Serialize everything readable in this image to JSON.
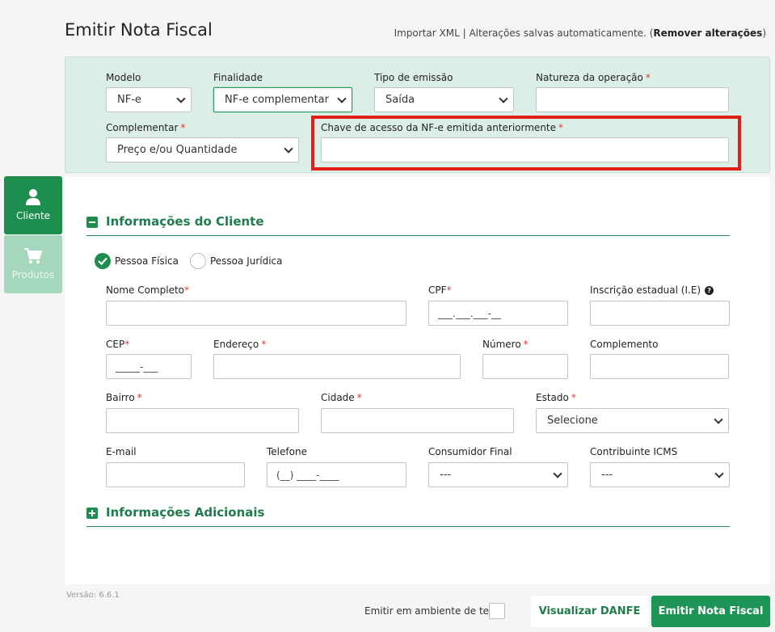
{
  "header": {
    "title": "Emitir Nota Fiscal",
    "import_xml": "Importar XML",
    "separator": "|",
    "autosave_text": "Alterações salvas automaticamente.",
    "remove_open": "(",
    "remove_label": "Remover alterações",
    "remove_close": ")"
  },
  "top_form": {
    "modelo": {
      "label": "Modelo",
      "value": "NF-e"
    },
    "finalidade": {
      "label": "Finalidade",
      "value": "NF-e complementar"
    },
    "tipo_emissao": {
      "label": "Tipo de emissão",
      "value": "Saída"
    },
    "natureza": {
      "label": "Natureza da operação",
      "required_mark": "*",
      "value": ""
    },
    "complementar": {
      "label": "Complementar",
      "required_mark": "*",
      "value": "Preço e/ou Quantidade"
    },
    "chave_acesso": {
      "label": "Chave de acesso da NF-e emitida anteriormente",
      "required_mark": "*",
      "value": ""
    }
  },
  "sidebar": {
    "items": [
      {
        "label": "Cliente",
        "icon": "user-icon",
        "active": true
      },
      {
        "label": "Produtos",
        "icon": "cart-icon",
        "active": false
      }
    ]
  },
  "cliente_section": {
    "title": "Informações do Cliente",
    "person_types": [
      {
        "label": "Pessoa Física",
        "selected": true
      },
      {
        "label": "Pessoa Jurídica",
        "selected": false
      }
    ],
    "fields": {
      "nome": {
        "label": "Nome Completo",
        "required_mark": "*",
        "value": ""
      },
      "cpf": {
        "label": "CPF",
        "required_mark": "*",
        "mask": "___.___.___-__"
      },
      "ie": {
        "label": "Inscrição estadual (I.E)",
        "help": "?",
        "value": ""
      },
      "cep": {
        "label": "CEP",
        "required_mark": "*",
        "mask": "_____-___"
      },
      "endereco": {
        "label": "Endereço",
        "required_mark": "*",
        "value": ""
      },
      "numero": {
        "label": "Número",
        "required_mark": "*",
        "value": ""
      },
      "complemento": {
        "label": "Complemento",
        "value": ""
      },
      "bairro": {
        "label": "Bairro",
        "required_mark": "*",
        "value": ""
      },
      "cidade": {
        "label": "Cidade",
        "required_mark": "*",
        "value": ""
      },
      "estado": {
        "label": "Estado",
        "required_mark": "*",
        "value": "Selecione"
      },
      "email": {
        "label": "E-mail",
        "value": ""
      },
      "telefone": {
        "label": "Telefone",
        "mask": "(__) ____-____"
      },
      "consumidor_final": {
        "label": "Consumidor Final",
        "value": "---"
      },
      "contribuinte_icms": {
        "label": "Contribuinte ICMS",
        "value": "---"
      }
    }
  },
  "adicionais_section": {
    "title": "Informações Adicionais"
  },
  "footer": {
    "version": "Versão: 6.6.1",
    "test_env_label": "Emitir em ambiente de teste",
    "view_button": "Visualizar DANFE",
    "emit_button": "Emitir Nota Fiscal"
  },
  "colors": {
    "primary": "#1e8e4f",
    "panel_bg": "#dcefe6",
    "highlight": "#e31c1c",
    "required": "#e53935"
  }
}
